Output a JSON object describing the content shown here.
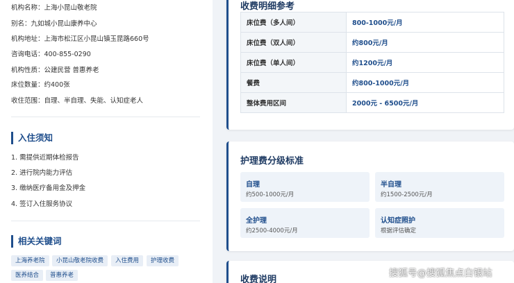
{
  "info": [
    {
      "label": "机构名称：",
      "value": "上海小昆山敬老院"
    },
    {
      "label": "别名：",
      "value": "九如城小昆山康养中心"
    },
    {
      "label": "机构地址：",
      "value": "上海市松江区小昆山镇玉昆路660号"
    },
    {
      "label": "咨询电话：",
      "value": "400-855-0290"
    },
    {
      "label": "机构性质：",
      "value": "公建民营 普惠养老"
    },
    {
      "label": "床位数量：",
      "value": "约400张"
    },
    {
      "label": "收住范围：",
      "value": "自理、半自理、失能、认知症老人"
    }
  ],
  "admission": {
    "title": "入住须知",
    "items": [
      "1. 需提供近期体检报告",
      "2. 进行院内能力评估",
      "3. 缴纳医疗备用金及押金",
      "4. 签订入住服务协议"
    ]
  },
  "keywords": {
    "title": "相关关键词",
    "tags": [
      "上海养老院",
      "小昆山敬老院收费",
      "入住费用",
      "护理收费",
      "医养结合",
      "普惠养老"
    ]
  },
  "fees": {
    "title": "收费明细参考",
    "rows": [
      {
        "item": "床位费（多人间）",
        "price": "800-1000元/月"
      },
      {
        "item": "床位费（双人间）",
        "price": "约800元/月"
      },
      {
        "item": "床位费（单人间）",
        "price": "约1200元/月"
      },
      {
        "item": "餐费",
        "price": "约800-1000元/月"
      },
      {
        "item": "整体费用区间",
        "price": "2000元 - 6500元/月"
      }
    ]
  },
  "care": {
    "title": "护理费分级标准",
    "grades": [
      {
        "name": "自理",
        "price": "约500-1000元/月"
      },
      {
        "name": "半自理",
        "price": "约1500-2500元/月"
      },
      {
        "name": "全护理",
        "price": "约2500-4000元/月"
      },
      {
        "name": "认知症照护",
        "price": "根据评估确定"
      }
    ]
  },
  "notes": {
    "title": "收费说明"
  },
  "watermark": "搜狐号@搜狐焦点白银站",
  "colors": {
    "accent": "#1f4e8c",
    "background": "#f0f3f7",
    "tag_bg": "#e8eef6"
  }
}
